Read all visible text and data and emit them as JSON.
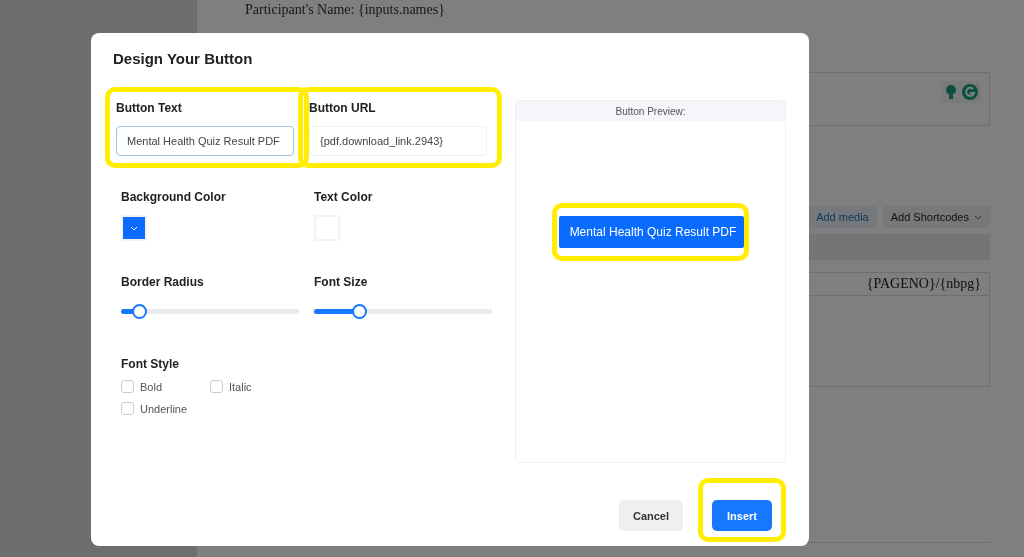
{
  "document": {
    "lines": [
      "Participant's Name: {inputs.names}"
    ],
    "toolbar": [
      {
        "label": "Add media",
        "kind": "link"
      },
      {
        "label": "Add Shortcodes",
        "kind": "dropdown"
      }
    ],
    "footer_field": "{PAGENO}/{nbpg}"
  },
  "dialog": {
    "title": "Design Your Button",
    "fields": [
      {
        "label": "Button Text",
        "value": "Mental Health Quiz Result PDF",
        "focused": true,
        "highlighted": true
      },
      {
        "label": "Button URL",
        "value": "{pdf.download_link.2943}",
        "focused": false,
        "highlighted": true
      }
    ],
    "colors": [
      {
        "label": "Background Color",
        "color": "#0a6cff",
        "kind": "dropdown"
      },
      {
        "label": "Text Color",
        "color": "#ffffff",
        "kind": "plain"
      }
    ],
    "sliders": [
      {
        "label": "Border Radius",
        "level": 0.1
      },
      {
        "label": "Font Size",
        "level": 0.25
      }
    ],
    "font_style": {
      "label": "Font Style",
      "options": [
        {
          "label": "Bold",
          "checked": false
        },
        {
          "label": "Italic",
          "checked": false
        },
        {
          "label": "Underline",
          "checked": false
        }
      ]
    },
    "preview": {
      "title": "Button Preview:",
      "button_text": "Mental Health Quiz Result PDF",
      "highlighted": true
    },
    "buttons": [
      {
        "label": "Cancel",
        "kind": "secondary",
        "highlighted": false
      },
      {
        "label": "Insert",
        "kind": "primary",
        "highlighted": true
      }
    ]
  }
}
